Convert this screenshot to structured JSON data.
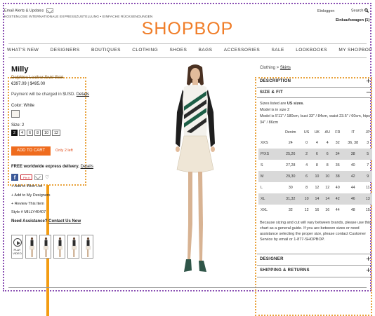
{
  "header": {
    "email_alerts": "Email Alerts & Updates",
    "shipping_line": "KOSTENLOSE INTERNATIONALE EXPRESSZUSTELLUNG • EINFACHE RÜCKSENDUNGEN",
    "sign_in": "Einloggen",
    "search": "Search",
    "cart": "Einkaufswagen (1)",
    "logo": "SHOPBOP"
  },
  "nav": [
    "WHAT'S NEW",
    "DESIGNERS",
    "BOUTIQUES",
    "CLOTHING",
    "SHOES",
    "BAGS",
    "ACCESSORIES",
    "SALE",
    "LOOKBOOKS",
    "MY SHOPBOP"
  ],
  "product": {
    "brand": "Milly",
    "name": "Dolphine Leather Swirl Skirt",
    "price": "€397.09  |  $495.00",
    "payment_note": "Payment will be charged in $USD.",
    "payment_details_link": "Details",
    "color_label": "Color: White",
    "size_label": "Size: 2",
    "sizes": [
      "2",
      "4",
      "6",
      "8",
      "10",
      "12"
    ],
    "selected_size": "2",
    "add_to_cart": "ADD TO CART",
    "only_left": "Only 2 left",
    "free_ship": "FREE worldwide express delivery.",
    "free_ship_details": "Details",
    "pinit": "Pin it",
    "add_wishlist": "+ Add to Wish List",
    "add_designers": "+ Add to My Designers",
    "review": "+ Review This Item",
    "style": "Style # MILLY40407",
    "assistance": "Need Assistance?",
    "contact": "Contact Us Now",
    "play_video": "PLAY VIDEO"
  },
  "right_panel": {
    "breadcrumb_root": "Clothing >",
    "breadcrumb_leaf": "Skirts",
    "description_title": "DESCRIPTION",
    "size_fit_title": "SIZE & FIT",
    "size_note_prefix": "Sizes listed are",
    "size_note_bold": "US sizes",
    "size_note_line2": "Model is in size 2",
    "size_note_line3": "Model is 5'11\" / 180cm, bust 33\" / 84cm, waist 23.5\" / 60cm, hips 34\" / 86cm",
    "table_headers": [
      "",
      "Denim",
      "US",
      "UK",
      "AU",
      "FR",
      "IT",
      "JP"
    ],
    "table_rows": [
      [
        "XXS",
        "24",
        "0",
        "4",
        "4",
        "32",
        "36, 38",
        "3"
      ],
      [
        "P/XS",
        "25,26",
        "2",
        "6",
        "6",
        "34",
        "38",
        "5"
      ],
      [
        "S",
        "27,28",
        "4",
        "8",
        "8",
        "36",
        "40",
        "7"
      ],
      [
        "M",
        "29,30",
        "6",
        "10",
        "10",
        "38",
        "42",
        "9"
      ],
      [
        "L",
        "30",
        "8",
        "12",
        "12",
        "40",
        "44",
        "11"
      ],
      [
        "XL",
        "31,32",
        "10",
        "14",
        "14",
        "42",
        "46",
        "13"
      ],
      [
        "XXL",
        "32",
        "12",
        "16",
        "16",
        "44",
        "48",
        "15"
      ]
    ],
    "disclaimer": "Because sizing and cut will vary between brands, please use this chart as a general guide. If you are between sizes or need assistance selecting the proper size, please contact Customer Service by email or 1-877-SHOPBOP.",
    "designer_title": "DESIGNER",
    "shipping_title": "SHIPPING & RETURNS"
  },
  "colors": {
    "brand_orange": "#f07d28",
    "cart_button": "#ef6c1e",
    "annotation_orange": "#e9a23b",
    "annotation_purple": "#8a4fb3"
  }
}
